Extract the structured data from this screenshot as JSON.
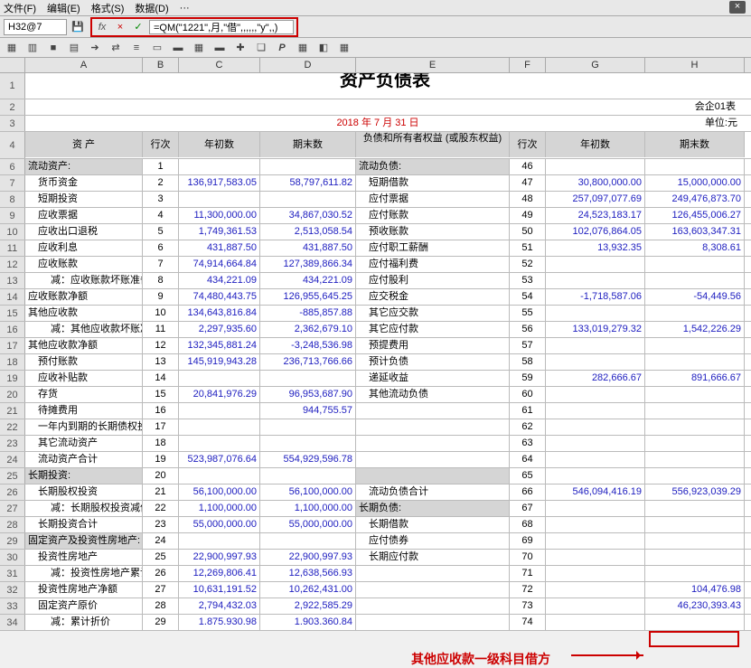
{
  "menu": {
    "file": "文件(F)",
    "edit": "编辑(E)",
    "format": "格式(S)",
    "data": "数据(D)",
    "more1": "···",
    "more2": "···"
  },
  "cell_ref": "H32@7",
  "formula": "=QM(\"1221\",月,\"借\",,,,,,\"y\",,)",
  "title": "资产负债表",
  "corp_code": "会企01表",
  "date": "2018 年  7 月  31 日",
  "unit": "单位:元",
  "headers": {
    "asset": "资 产",
    "row": "行次",
    "begin": "年初数",
    "end": "期末数",
    "liab": "负债和所有者权益\n(或股东权益)"
  },
  "annotation": "其他应收款一级科目借方",
  "rows": [
    {
      "r": 6,
      "a": "流动资产:",
      "b": "1",
      "ga": true,
      "e": "流动负债:",
      "f": "46",
      "ge": true
    },
    {
      "r": 7,
      "a": "货币资金",
      "ai": 1,
      "b": "2",
      "c": "136,917,583.05",
      "d": "58,797,611.82",
      "e": "短期借款",
      "ei": 1,
      "f": "47",
      "g": "30,800,000.00",
      "h": "15,000,000.00"
    },
    {
      "r": 8,
      "a": "短期投资",
      "ai": 1,
      "b": "3",
      "e": "应付票据",
      "ei": 1,
      "f": "48",
      "g": "257,097,077.69",
      "h": "249,476,873.70"
    },
    {
      "r": 9,
      "a": "应收票据",
      "ai": 1,
      "b": "4",
      "c": "11,300,000.00",
      "d": "34,867,030.52",
      "e": "应付账款",
      "ei": 1,
      "f": "49",
      "g": "24,523,183.17",
      "h": "126,455,006.27"
    },
    {
      "r": 10,
      "a": "应收出口退税",
      "ai": 1,
      "b": "5",
      "c": "1,749,361.53",
      "d": "2,513,058.54",
      "e": "预收账款",
      "ei": 1,
      "f": "50",
      "g": "102,076,864.05",
      "h": "163,603,347.31"
    },
    {
      "r": 11,
      "a": "应收利息",
      "ai": 1,
      "b": "6",
      "c": "431,887.50",
      "d": "431,887.50",
      "e": "应付职工薪酬",
      "ei": 1,
      "f": "51",
      "g": "13,932.35",
      "h": "8,308.61"
    },
    {
      "r": 12,
      "a": "应收账款",
      "ai": 1,
      "b": "7",
      "c": "74,914,664.84",
      "d": "127,389,866.34",
      "e": "应付福利费",
      "ei": 1,
      "f": "52"
    },
    {
      "r": 13,
      "a": "减：应收账款坏账准备",
      "ai": 2,
      "b": "8",
      "c": "434,221.09",
      "d": "434,221.09",
      "e": "应付股利",
      "ei": 1,
      "f": "53"
    },
    {
      "r": 14,
      "a": "应收账款净额",
      "b": "9",
      "c": "74,480,443.75",
      "d": "126,955,645.25",
      "e": "应交税金",
      "ei": 1,
      "f": "54",
      "g": "-1,718,587.06",
      "h": "-54,449.56"
    },
    {
      "r": 15,
      "a": "其他应收款",
      "b": "10",
      "c": "134,643,816.84",
      "d": "-885,857.88",
      "e": "其它应交款",
      "ei": 1,
      "f": "55"
    },
    {
      "r": 16,
      "a": "减：其他应收款坏账准备",
      "ai": 2,
      "b": "11",
      "c": "2,297,935.60",
      "d": "2,362,679.10",
      "e": "其它应付款",
      "ei": 1,
      "f": "56",
      "g": "133,019,279.32",
      "h": "1,542,226.29"
    },
    {
      "r": 17,
      "a": "其他应收款净额",
      "b": "12",
      "c": "132,345,881.24",
      "d": "-3,248,536.98",
      "e": "预提费用",
      "ei": 1,
      "f": "57"
    },
    {
      "r": 18,
      "a": "预付账款",
      "ai": 1,
      "b": "13",
      "c": "145,919,943.28",
      "d": "236,713,766.66",
      "e": "预计负债",
      "ei": 1,
      "f": "58"
    },
    {
      "r": 19,
      "a": "应收补贴款",
      "ai": 1,
      "b": "14",
      "e": "递延收益",
      "ei": 1,
      "f": "59",
      "g": "282,666.67",
      "h": "891,666.67"
    },
    {
      "r": 20,
      "a": "存货",
      "ai": 1,
      "b": "15",
      "c": "20,841,976.29",
      "d": "96,953,687.90",
      "e": "其他流动负债",
      "ei": 1,
      "f": "60"
    },
    {
      "r": 21,
      "a": "待摊费用",
      "ai": 1,
      "b": "16",
      "d": "944,755.57",
      "f": "61"
    },
    {
      "r": 22,
      "a": "一年内到期的长期债权投资",
      "ai": 1,
      "b": "17",
      "f": "62"
    },
    {
      "r": 23,
      "a": "其它流动资产",
      "ai": 1,
      "b": "18",
      "f": "63"
    },
    {
      "r": 24,
      "a": "流动资产合计",
      "ai": 1,
      "b": "19",
      "c": "523,987,076.64",
      "d": "554,929,596.78",
      "f": "64"
    },
    {
      "r": 25,
      "a": "长期投资:",
      "b": "20",
      "ga": true,
      "f": "65",
      "ge": true
    },
    {
      "r": 26,
      "a": "长期股权投资",
      "ai": 1,
      "b": "21",
      "c": "56,100,000.00",
      "d": "56,100,000.00",
      "e": "流动负债合计",
      "ei": 1,
      "f": "66",
      "g": "546,094,416.19",
      "h": "556,923,039.29"
    },
    {
      "r": 27,
      "a": "减：长期股权投资减值准备",
      "ai": 2,
      "b": "22",
      "c": "1,100,000.00",
      "d": "1,100,000.00",
      "e": "长期负债:",
      "f": "67",
      "ge": true
    },
    {
      "r": 28,
      "a": "长期投资合计",
      "ai": 1,
      "b": "23",
      "c": "55,000,000.00",
      "d": "55,000,000.00",
      "e": "长期借款",
      "ei": 1,
      "f": "68"
    },
    {
      "r": 29,
      "a": "固定资产及投资性房地产:",
      "b": "24",
      "ga": true,
      "e": "应付债券",
      "ei": 1,
      "f": "69"
    },
    {
      "r": 30,
      "a": "投资性房地产",
      "ai": 1,
      "b": "25",
      "c": "22,900,997.93",
      "d": "22,900,997.93",
      "e": "长期应付款",
      "ei": 1,
      "f": "70"
    },
    {
      "r": 31,
      "a": "减：投资性房地产累计折旧",
      "ai": 2,
      "b": "26",
      "c": "12,269,806.41",
      "d": "12,638,566.93",
      "f": "71"
    },
    {
      "r": 32,
      "a": "投资性房地产净额",
      "ai": 1,
      "b": "27",
      "c": "10,631,191.52",
      "d": "10,262,431.00",
      "f": "72",
      "h": "104,476.98",
      "hbox": true
    },
    {
      "r": 33,
      "a": "固定资产原价",
      "ai": 1,
      "b": "28",
      "c": "2,794,432.03",
      "d": "2,922,585.29",
      "f": "73",
      "h": "46,230,393.43"
    },
    {
      "r": 34,
      "a": "减：累计折价",
      "ai": 2,
      "b": "29",
      "c": "1.875.930.98",
      "d": "1.903.360.84",
      "f": "74"
    }
  ]
}
